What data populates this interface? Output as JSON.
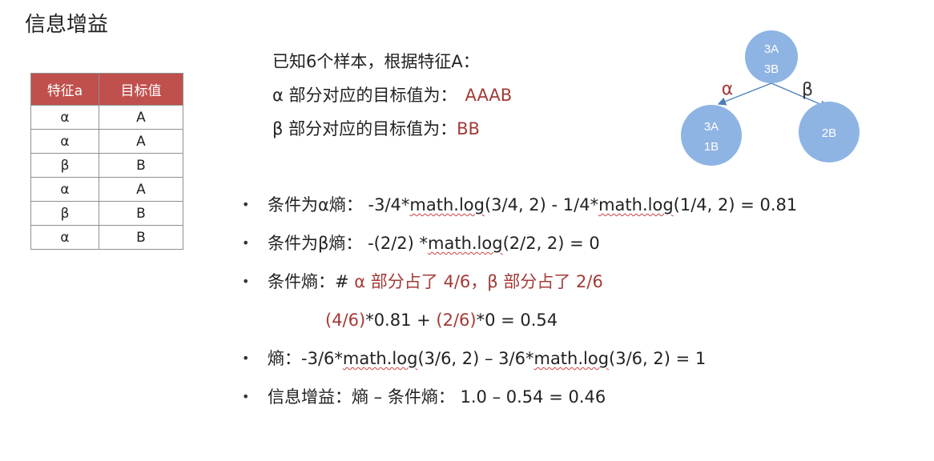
{
  "title": "信息增益",
  "table": {
    "headers": [
      "特征a",
      "目标值"
    ],
    "rows": [
      {
        "feature": "α",
        "target": "A"
      },
      {
        "feature": "α",
        "target": "A"
      },
      {
        "feature": "β",
        "target": "B"
      },
      {
        "feature": "α",
        "target": "A"
      },
      {
        "feature": "β",
        "target": "B"
      },
      {
        "feature": "α",
        "target": "B"
      }
    ]
  },
  "intro": {
    "line1": "已知6个样本，根据特征A：",
    "line2_prefix": "α 部分对应的目标值为：",
    "line2_value": "AAAB",
    "line3_prefix": "β 部分对应的目标值为：",
    "line3_value": "BB"
  },
  "tree": {
    "root": [
      "3A",
      "3B"
    ],
    "left_edge": "α",
    "right_edge": "β",
    "left_child": [
      "3A",
      "1B"
    ],
    "right_child": [
      "2B"
    ],
    "node_color": "#8eb4e3"
  },
  "bullets": {
    "b1_prefix": "条件为α熵：  -3/4*",
    "b1_log1": "math.log",
    "b1_mid": "(3/4, 2) - 1/4*",
    "b1_log2": "math.log",
    "b1_suffix": "(1/4, 2) = 0.81",
    "b2_prefix": "条件为β熵：  -(2/2)  *",
    "b2_log": "math.log",
    "b2_suffix": "(2/2, 2) = 0",
    "b3_prefix": "条件熵：# ",
    "b3_red": "α 部分占了 4/6，β 部分占了 2/6",
    "b3b_red1": "(4/6)",
    "b3b_mid": "*0.81 + ",
    "b3b_red2": "(2/6)",
    "b3b_suffix": "*0 = 0.54",
    "b4_prefix": "熵：-3/6*",
    "b4_log1": "math.log",
    "b4_mid": "(3/6, 2) – 3/6*",
    "b4_log2": "math.log",
    "b4_suffix": "(3/6, 2) = 1",
    "b5": "信息增益：熵 – 条件熵：  1.0 – 0.54 = 0.46",
    "bullet_char": "•"
  }
}
